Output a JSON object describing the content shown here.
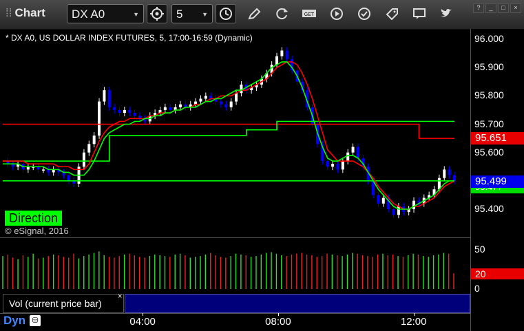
{
  "toolbar": {
    "title": "Chart",
    "symbol": "DX A0",
    "interval": "5",
    "get_label": "GET"
  },
  "chart": {
    "title": "* DX A0, US DOLLAR INDEX FUTURES, 5, 17:00-16:59 (Dynamic)",
    "direction_label": "Direction",
    "copyright": "© eSignal, 2016",
    "last_price_tag": "95.499",
    "upper_band_tag": "95.651",
    "lower_band_tag": "95.477",
    "volume_tag": "20",
    "study_label": "Vol (current price bar)",
    "close_symbol": "×",
    "footer_label": "Dyn",
    "colors": {
      "up_candle": "#ffffff",
      "down_candle": "#0000ff",
      "upper_line": "#ff0000",
      "lower_line": "#00ff00",
      "background": "#000000"
    }
  },
  "chart_data": [
    {
      "type": "line",
      "title": "* DX A0, US DOLLAR INDEX FUTURES, 5, 17:00-16:59 (Dynamic)",
      "y_ticks": [
        "96.000",
        "95.900",
        "95.800",
        "95.700",
        "95.600",
        "95.500",
        "95.400"
      ],
      "x_ticks": [
        "04:00",
        "08:00",
        "12:00"
      ],
      "ylim": [
        95.34,
        96.02
      ],
      "series": [
        {
          "values": [
            95.57,
            95.56,
            95.55,
            95.56,
            95.54,
            95.55,
            95.55,
            95.54,
            95.54,
            95.53,
            95.54,
            95.53,
            95.52,
            95.5,
            95.49,
            95.55,
            95.6,
            95.63,
            95.66,
            95.78,
            95.82,
            95.76,
            95.75,
            95.74,
            95.75,
            95.74,
            95.73,
            95.72,
            95.71,
            95.73,
            95.74,
            95.75,
            95.76,
            95.75,
            95.76,
            95.77,
            95.76,
            95.77,
            95.78,
            95.79,
            95.8,
            95.79,
            95.78,
            95.77,
            95.76,
            95.78,
            95.81,
            95.84,
            95.82,
            95.83,
            95.84,
            95.86,
            95.88,
            95.91,
            95.94,
            95.96,
            95.93,
            95.89,
            95.85,
            95.82,
            95.76,
            95.7,
            95.63,
            95.57,
            95.55,
            95.56,
            95.54,
            95.57,
            95.6,
            95.62,
            95.58,
            95.55,
            95.5,
            95.45,
            95.42,
            95.44,
            95.4,
            95.38,
            95.41,
            95.39,
            95.4,
            95.43,
            95.42,
            95.44,
            95.45,
            95.47,
            95.51,
            95.54,
            95.52,
            95.5
          ]
        },
        {
          "name": "",
          "values": [
            95.57,
            95.57,
            95.57,
            95.57,
            95.57,
            95.56,
            95.56,
            95.56,
            95.56,
            95.56,
            95.56,
            95.55,
            95.55,
            95.55,
            95.54,
            95.54,
            95.54,
            95.56,
            95.6,
            95.64,
            95.67,
            95.69,
            95.7,
            95.71,
            95.71,
            95.72,
            95.72,
            95.72,
            95.72,
            95.73,
            95.73,
            95.74,
            95.74,
            95.74,
            95.75,
            95.75,
            95.76,
            95.76,
            95.77,
            95.77,
            95.78,
            95.79,
            95.79,
            95.8,
            95.8,
            95.8,
            95.81,
            95.82,
            95.82,
            95.83,
            95.84,
            95.85,
            95.86,
            95.88,
            95.9,
            95.91,
            95.92,
            95.92,
            95.91,
            95.88,
            95.84,
            95.79,
            95.73,
            95.67,
            95.61,
            95.59,
            95.57,
            95.57,
            95.57,
            95.57,
            95.56,
            95.55,
            95.53,
            95.51,
            95.48,
            95.46,
            95.44,
            95.42,
            95.41,
            95.4,
            95.4,
            95.41,
            95.41,
            95.42,
            95.43,
            95.44,
            95.46,
            95.48,
            95.49,
            95.5
          ]
        },
        {
          "name": "",
          "values": [
            95.56,
            95.56,
            95.56,
            95.56,
            95.55,
            95.55,
            95.55,
            95.55,
            95.55,
            95.54,
            95.54,
            95.54,
            95.53,
            95.53,
            95.52,
            95.52,
            95.52,
            95.54,
            95.57,
            95.61,
            95.65,
            95.67,
            95.68,
            95.69,
            95.7,
            95.7,
            95.71,
            95.71,
            95.72,
            95.72,
            95.73,
            95.73,
            95.74,
            95.74,
            95.75,
            95.75,
            95.76,
            95.76,
            95.76,
            95.77,
            95.78,
            95.78,
            95.79,
            95.79,
            95.8,
            95.81,
            95.82,
            95.82,
            95.83,
            95.84,
            95.85,
            95.86,
            95.88,
            95.9,
            95.91,
            95.92,
            95.92,
            95.9,
            95.87,
            95.83,
            95.78,
            95.73,
            95.67,
            95.62,
            95.58,
            95.57,
            95.57,
            95.58,
            95.59,
            95.59,
            95.58,
            95.56,
            95.53,
            95.5,
            95.47,
            95.45,
            95.43,
            95.41,
            95.4,
            95.4,
            95.4,
            95.41,
            95.42,
            95.43,
            95.44,
            95.45,
            95.47,
            95.49,
            95.5,
            95.5
          ]
        },
        {
          "name": "",
          "values": [
            95.7,
            95.7,
            95.7,
            95.7,
            95.7,
            95.7,
            95.7,
            95.7,
            95.7,
            95.7,
            95.7,
            95.7,
            95.7,
            95.7,
            95.7,
            95.7,
            95.7,
            95.7,
            95.7,
            95.7,
            95.7,
            95.7,
            95.7,
            95.7,
            95.7,
            95.7,
            95.7,
            95.7,
            95.7,
            95.7,
            95.7,
            95.7,
            95.7,
            95.7,
            95.7,
            95.7,
            95.7,
            95.7,
            95.7,
            95.7,
            95.7,
            95.7,
            95.7,
            95.7,
            95.7,
            95.7,
            95.7,
            95.7,
            95.7,
            95.7,
            95.7,
            95.7,
            95.7,
            95.7,
            95.7,
            95.7,
            95.7,
            95.7,
            95.7,
            95.7,
            95.7,
            95.7,
            95.7,
            95.7,
            95.7,
            95.7,
            95.7,
            95.7,
            95.7,
            95.7,
            95.7,
            95.7,
            95.7,
            95.7,
            95.7,
            95.7,
            95.7,
            95.7,
            95.7,
            95.7,
            95.7,
            95.7,
            95.65,
            95.65,
            95.65,
            95.65,
            95.65,
            95.65,
            95.65,
            95.65
          ]
        },
        {
          "name": "",
          "values": [
            95.57,
            95.57,
            95.57,
            95.57,
            95.57,
            95.57,
            95.57,
            95.57,
            95.57,
            95.57,
            95.57,
            95.57,
            95.57,
            95.57,
            95.57,
            95.57,
            95.57,
            95.57,
            95.57,
            95.57,
            95.57,
            95.66,
            95.66,
            95.66,
            95.66,
            95.66,
            95.66,
            95.66,
            95.66,
            95.66,
            95.66,
            95.66,
            95.66,
            95.66,
            95.66,
            95.66,
            95.66,
            95.66,
            95.66,
            95.66,
            95.66,
            95.66,
            95.66,
            95.66,
            95.66,
            95.66,
            95.66,
            95.66,
            95.68,
            95.68,
            95.68,
            95.68,
            95.68,
            95.68,
            95.71,
            95.71,
            95.71,
            95.71,
            95.71,
            95.71,
            95.71,
            95.71,
            95.71,
            95.71,
            95.71,
            95.71,
            95.71,
            95.71,
            95.71,
            95.71,
            95.71,
            95.71,
            95.71,
            95.71,
            95.71,
            95.71,
            95.71,
            95.71,
            95.71,
            95.71,
            95.71,
            95.71,
            95.71,
            95.71,
            95.71,
            95.71,
            95.71,
            95.71,
            95.71,
            95.71
          ]
        },
        {
          "name": "",
          "values": [
            95.5,
            95.5,
            95.5,
            95.5,
            95.5,
            95.5,
            95.5,
            95.5,
            95.5,
            95.5,
            95.5,
            95.5,
            95.5,
            95.5,
            95.5,
            95.5,
            95.5,
            95.5,
            95.5,
            95.5,
            95.5,
            95.5,
            95.5,
            95.5,
            95.5,
            95.5,
            95.5,
            95.5,
            95.5,
            95.5,
            95.5,
            95.5,
            95.5,
            95.5,
            95.5,
            95.5,
            95.5,
            95.5,
            95.5,
            95.5,
            95.5,
            95.5,
            95.5,
            95.5,
            95.5,
            95.5,
            95.5,
            95.5,
            95.5,
            95.5,
            95.5,
            95.5,
            95.5,
            95.5,
            95.5,
            95.5,
            95.5,
            95.5,
            95.5,
            95.5,
            95.5,
            95.5,
            95.5,
            95.5,
            95.5,
            95.5,
            95.5,
            95.5,
            95.5,
            95.5,
            95.5,
            95.5,
            95.5,
            95.5,
            95.5,
            95.5,
            95.5,
            95.5,
            95.5,
            95.5,
            95.5,
            95.5,
            95.5,
            95.5,
            95.5,
            95.5,
            95.5,
            95.5,
            95.5,
            95.5
          ]
        }
      ]
    },
    {
      "type": "bar",
      "y_ticks": [
        "50",
        "0"
      ],
      "ylim": [
        0,
        60
      ],
      "values": [
        42,
        44,
        40,
        38,
        43,
        41,
        45,
        39,
        40,
        42,
        44,
        43,
        41,
        40,
        45,
        39,
        42,
        44,
        46,
        48,
        43,
        41,
        40,
        42,
        44,
        45,
        43,
        41,
        40,
        42,
        44,
        43,
        42,
        41,
        44,
        45,
        43,
        40,
        41,
        42,
        44,
        46,
        43,
        41,
        40,
        42,
        45,
        44,
        43,
        41,
        42,
        44,
        46,
        47,
        45,
        43,
        42,
        44,
        45,
        46,
        44,
        43,
        41,
        42,
        45,
        44,
        43,
        42,
        44,
        46,
        45,
        43,
        42,
        41,
        44,
        45,
        43,
        44,
        42,
        41,
        43,
        45,
        44,
        42,
        41,
        43,
        44,
        46,
        45,
        20
      ]
    }
  ]
}
